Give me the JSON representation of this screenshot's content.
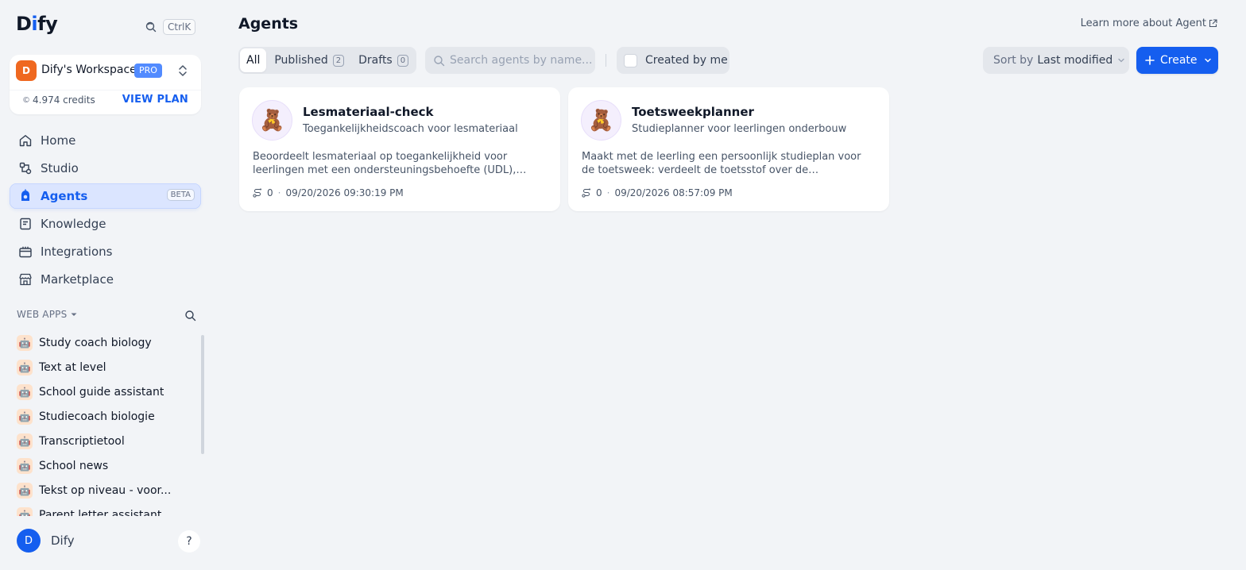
{
  "brand": {
    "logo_text_1": "D",
    "logo_text_2": "i",
    "logo_text_3": "fy"
  },
  "search_shortcut": {
    "key": "CtrlK"
  },
  "workspace": {
    "avatar_letter": "D",
    "name": "Dify's Workspace",
    "plan_badge": "PRO",
    "credits_icon": "©",
    "credits": "4.974 credits",
    "view_plan": "VIEW PLAN"
  },
  "nav": {
    "items": [
      {
        "label": "Home",
        "icon": "home-icon"
      },
      {
        "label": "Studio",
        "icon": "studio-icon"
      },
      {
        "label": "Agents",
        "icon": "agent-icon",
        "badge": "BETA",
        "active": true
      },
      {
        "label": "Knowledge",
        "icon": "book-icon"
      },
      {
        "label": "Integrations",
        "icon": "briefcase-icon"
      },
      {
        "label": "Marketplace",
        "icon": "store-icon"
      }
    ]
  },
  "webapps": {
    "header": "WEB APPS",
    "items": [
      {
        "label": "Study coach biology"
      },
      {
        "label": "Text at level"
      },
      {
        "label": "School guide assistant"
      },
      {
        "label": "Studiecoach biologie"
      },
      {
        "label": "Transcriptietool"
      },
      {
        "label": "School news"
      },
      {
        "label": "Tekst op niveau - voor..."
      },
      {
        "label": "Parent letter assistant"
      }
    ]
  },
  "user": {
    "avatar_letter": "D",
    "name": "Dify",
    "help": "?"
  },
  "main": {
    "title": "Agents",
    "learn_more": "Learn more about Agent",
    "tabs": [
      {
        "label": "All",
        "active": true
      },
      {
        "label": "Published",
        "count": "2"
      },
      {
        "label": "Drafts",
        "count": "0"
      }
    ],
    "search_placeholder": "Search agents by name...",
    "created_by_me": "Created by me",
    "sort_prefix": "Sort by",
    "sort_value": "Last modified",
    "create_label": "Create"
  },
  "cards": [
    {
      "title": "Lesmateriaal-check",
      "subtitle": "Toegankelijkheidscoach voor lesmateriaal",
      "description": "Beoordeelt lesmateriaal op toegankelijkheid voor leerlingen met een ondersteuningsbehoefte (UDL), maakt aangepast...",
      "runs": "0",
      "date": "09/20/2026 09:30:19 PM",
      "avatar": "🧸"
    },
    {
      "title": "Toetsweekplanner",
      "subtitle": "Studieplanner voor leerlingen onderbouw",
      "description": "Maakt met de leerling een persoonlijk studieplan voor de toetsweek: verdeelt de toetsstof over de beschikbare...",
      "runs": "0",
      "date": "09/20/2026 08:57:09 PM",
      "avatar": "🧸"
    }
  ],
  "colors": {
    "accent": "#155eef",
    "workspace_avatar": "#ef6820",
    "active_nav_bg": "#dbe5ff"
  }
}
